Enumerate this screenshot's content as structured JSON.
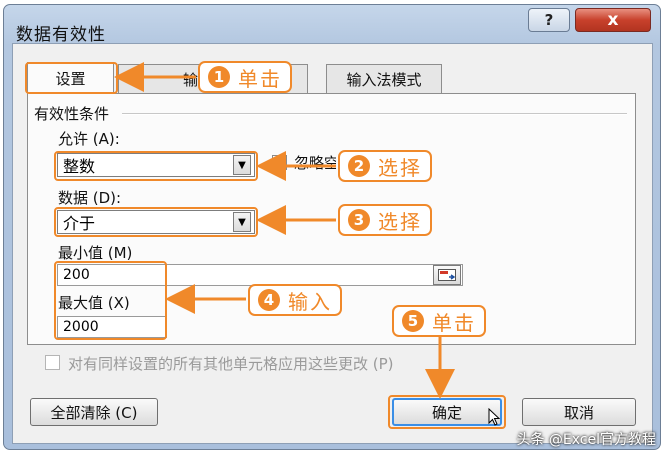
{
  "dialog": {
    "title": "数据有效性",
    "help_label": "?",
    "close_label": "x"
  },
  "tabs": [
    {
      "label": "设置"
    },
    {
      "label": "输入信息"
    },
    {
      "label": "输入法模式"
    }
  ],
  "settings": {
    "group_label": "有效性条件",
    "allow_label": "允许 (A):",
    "allow_value": "整数",
    "ignore_blank_label": "忽略空值",
    "data_label": "数据 (D):",
    "data_value": "介于",
    "min_label": "最小值 (M)",
    "min_value": "200",
    "max_label": "最大值 (X)",
    "max_value": "2000",
    "apply_all_label": "对有同样设置的所有其他单元格应用这些更改 (P)"
  },
  "buttons": {
    "clear_all": "全部清除 (C)",
    "ok": "确定",
    "cancel": "取消"
  },
  "annotations": {
    "step1": {
      "num": "1",
      "text": "单击"
    },
    "step2": {
      "num": "2",
      "text": "选择"
    },
    "step3": {
      "num": "3",
      "text": "选择"
    },
    "step4": {
      "num": "4",
      "text": "输入"
    },
    "step5": {
      "num": "5",
      "text": "单击"
    }
  },
  "watermark": "头条 @Excel官方教程",
  "colors": {
    "annotation_orange": "#f0892a",
    "title_bar": "#b3c7e0",
    "close_button": "#c8412c"
  }
}
